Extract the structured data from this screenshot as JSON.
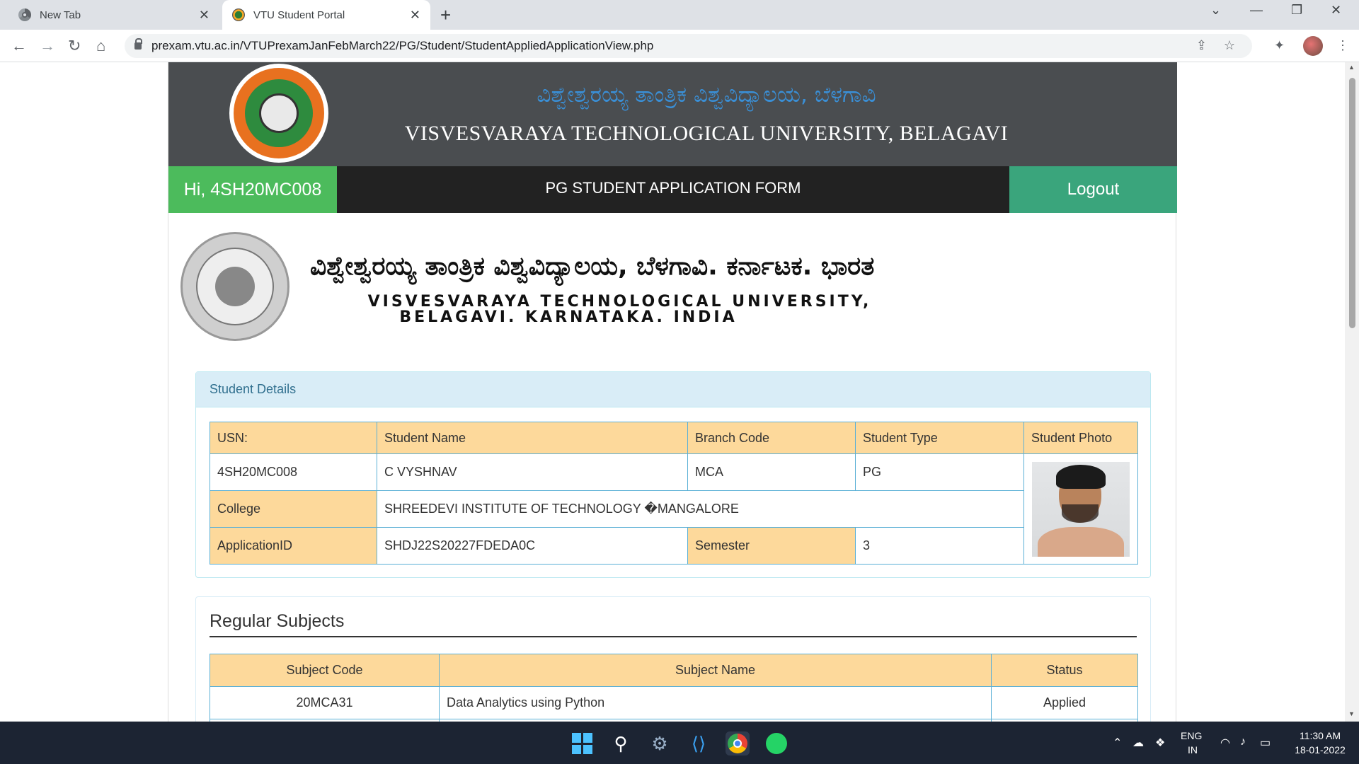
{
  "browser": {
    "tabs": [
      {
        "title": "New Tab",
        "active": false
      },
      {
        "title": "VTU Student Portal",
        "active": true
      }
    ],
    "new_tab_symbol": "+",
    "url": "prexam.vtu.ac.in/VTUPrexamJanFebMarch22/PG/Student/StudentAppliedApplicationView.php"
  },
  "header": {
    "kannada_title": "ವಿಶ್ವೇಶ್ವರಯ್ಯ ತಾಂತ್ರಿಕ ವಿಶ್ವವಿದ್ಯಾಲಯ, ಬೆಳಗಾವಿ",
    "english_title": "VISVESVARAYA TECHNOLOGICAL UNIVERSITY, BELAGAVI"
  },
  "navbar": {
    "greeting": "Hi, 4SH20MC008",
    "form_title": "PG STUDENT APPLICATION FORM",
    "logout": "Logout"
  },
  "banner": {
    "kannada": "ವಿಶ್ವೇಶ್ವರಯ್ಯ ತಾಂತ್ರಿಕ ವಿಶ್ವವಿದ್ಯಾಲಯ, ಬೆಳಗಾವಿ. ಕರ್ನಾಟಕ. ಭಾರತ",
    "english_line1": "VISVESVARAYA TECHNOLOGICAL UNIVERSITY,",
    "english_line2": "BELAGAVI. KARNATAKA. INDIA"
  },
  "student_details": {
    "heading": "Student Details",
    "labels": {
      "usn": "USN:",
      "name": "Student Name",
      "branch": "Branch Code",
      "type": "Student Type",
      "photo": "Student Photo",
      "college": "College",
      "application_id": "ApplicationID",
      "semester": "Semester"
    },
    "values": {
      "usn": "4SH20MC008",
      "name": "C VYSHNAV",
      "branch": "MCA",
      "type": "PG",
      "college": "SHREEDEVI INSTITUTE OF TECHNOLOGY �MANGALORE",
      "application_id": "SHDJ22S20227FDEDA0C",
      "semester": "3"
    }
  },
  "regular_subjects": {
    "heading": "Regular Subjects",
    "columns": [
      "Subject Code",
      "Subject Name",
      "Status"
    ],
    "rows": [
      {
        "code": "20MCA31",
        "name": "Data Analytics using Python",
        "status": "Applied"
      }
    ]
  },
  "taskbar": {
    "language": "ENG",
    "region": "IN",
    "time": "11:30 AM",
    "date": "18-01-2022"
  },
  "colors": {
    "header_bg": "#4a4d50",
    "greeting_bg": "#4cbb5c",
    "logout_bg": "#3aa57c",
    "label_cell_bg": "#fdd99b",
    "panel_heading_bg": "#d9edf7"
  }
}
